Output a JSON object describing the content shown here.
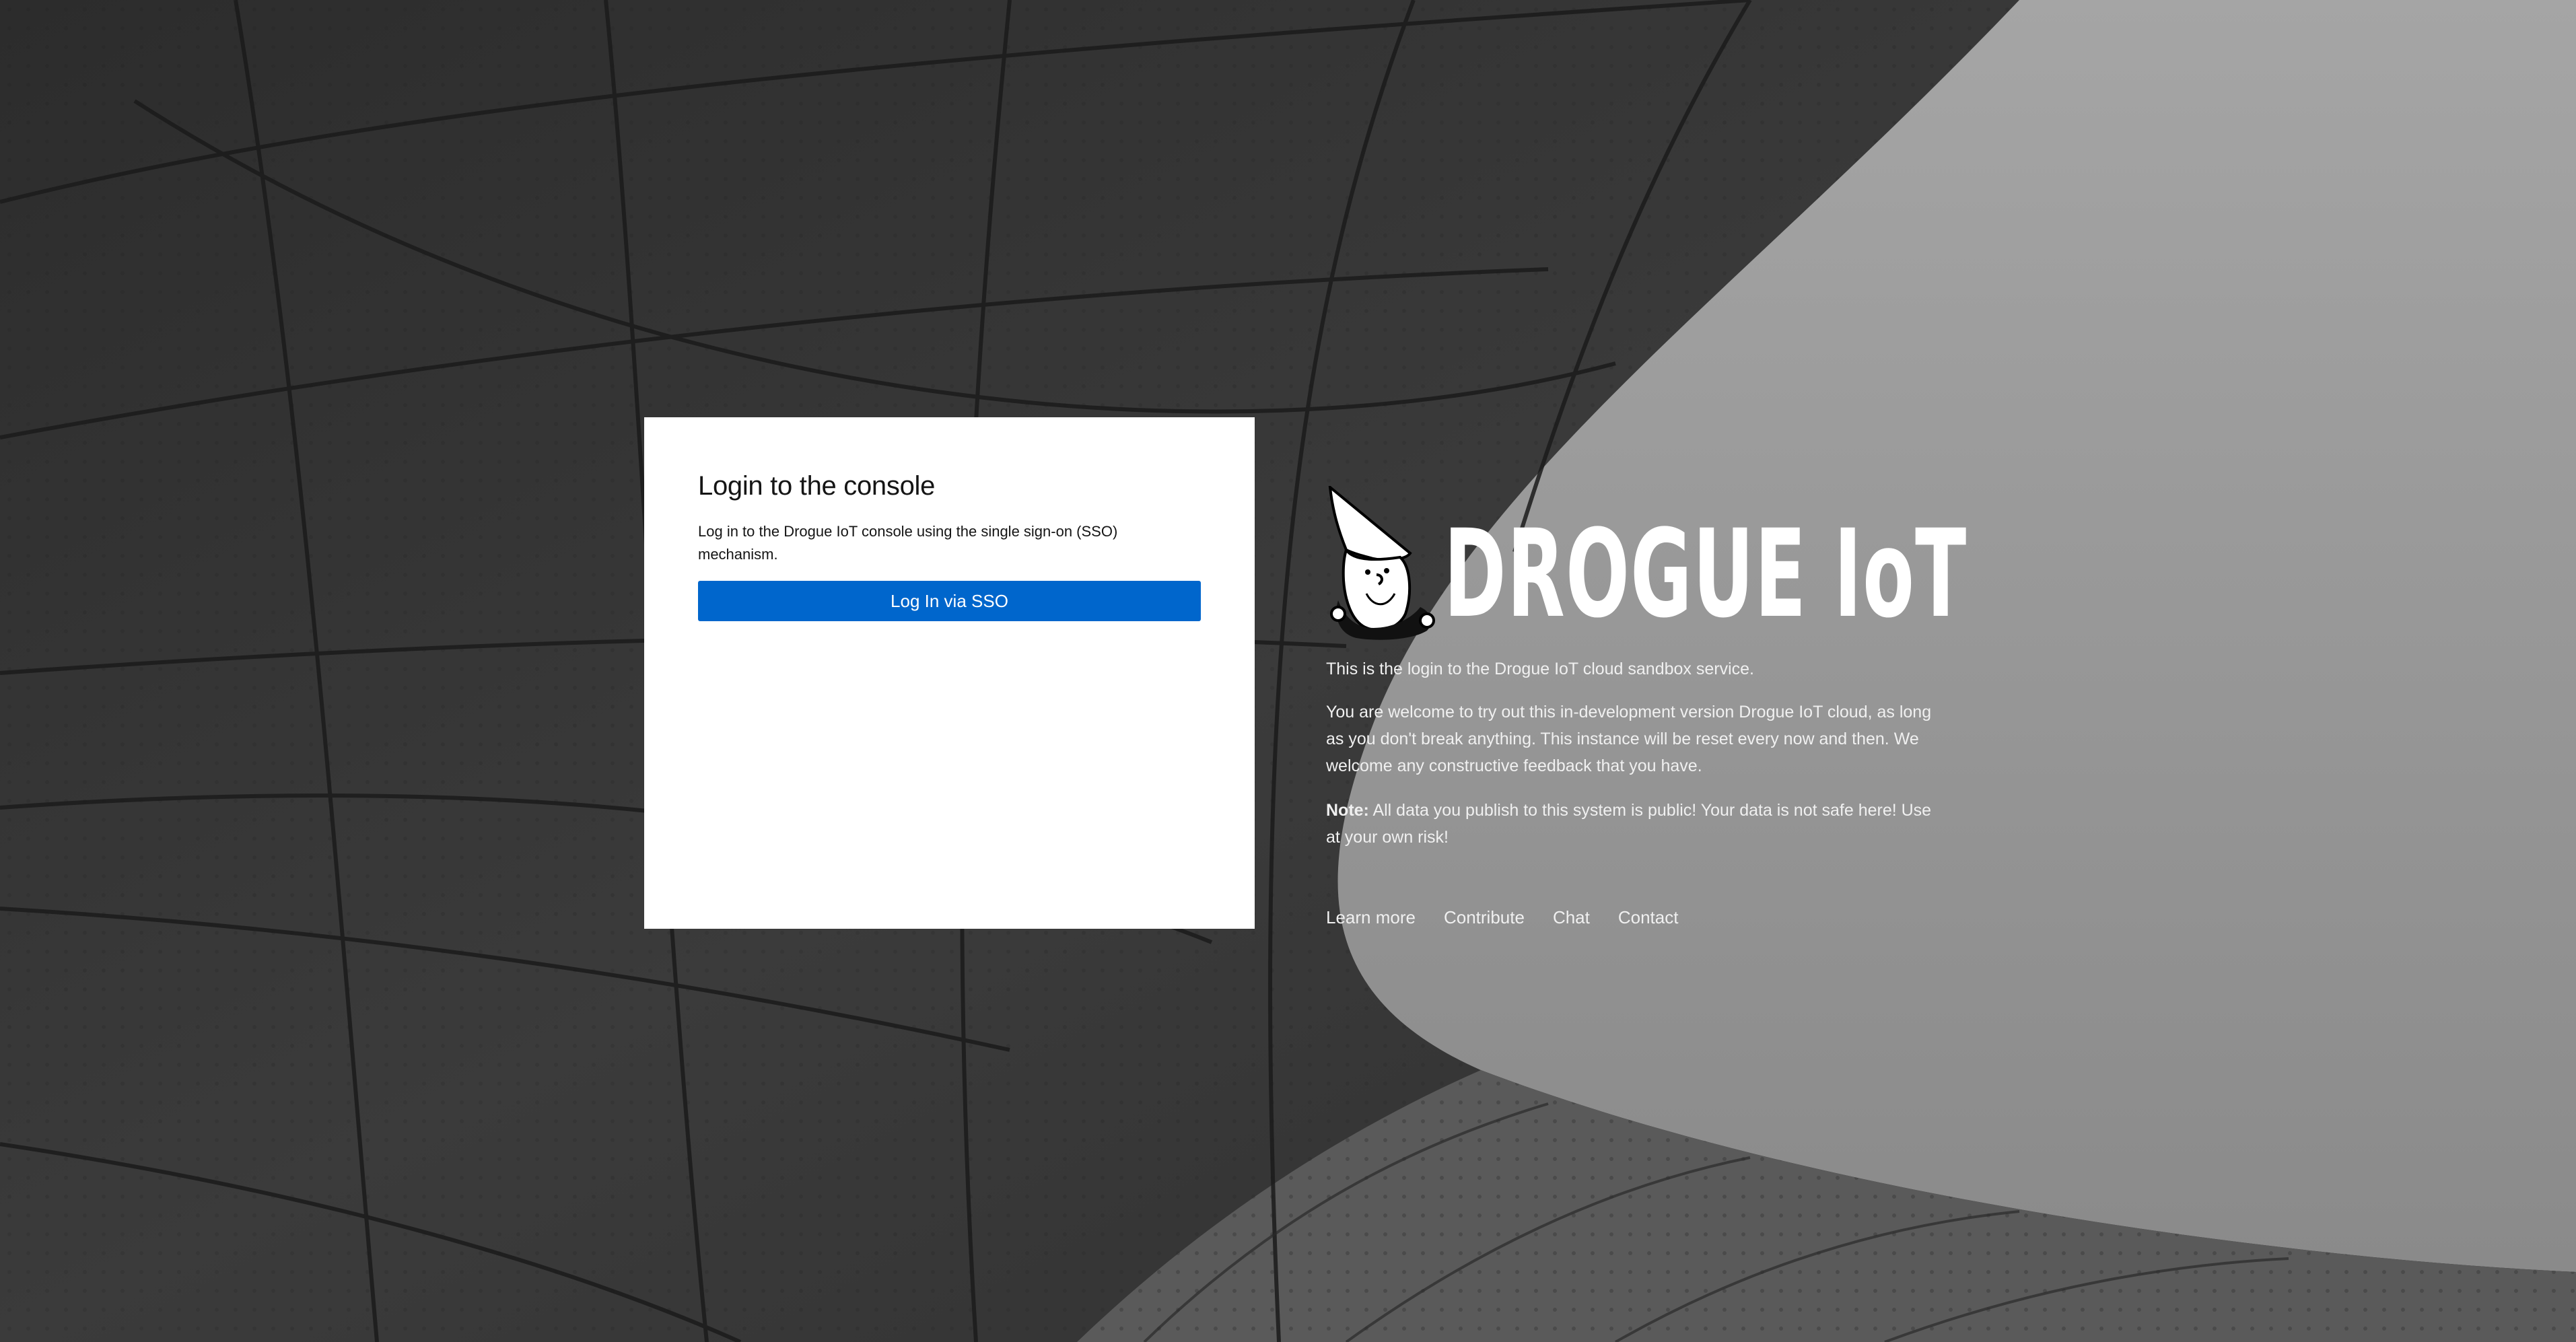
{
  "login": {
    "title": "Login to the console",
    "description": "Log in to the Drogue IoT console using the single sign-on (SSO) mechanism.",
    "sso_button_label": "Log In via SSO"
  },
  "brand": {
    "wordmark": "DROGUE IoT",
    "mascot_icon": "gnome-mascot-icon"
  },
  "info": {
    "intro": "This is the login to the Drogue IoT cloud sandbox service.",
    "welcome": "You are welcome to try out this in-development version Drogue IoT cloud, as long as you don't break anything. This instance will be reset every now and then. We welcome any constructive feedback that you have.",
    "note_label": "Note:",
    "note_text": " All data you publish to this system is public! Your data is not safe here! Use at your own risk!"
  },
  "footer_links": [
    {
      "label": "Learn more"
    },
    {
      "label": "Contribute"
    },
    {
      "label": "Chat"
    },
    {
      "label": "Contact"
    }
  ],
  "colors": {
    "primary_button": "#0066cc",
    "card_background": "#ffffff",
    "text_on_dark": "#f0f0f0"
  }
}
